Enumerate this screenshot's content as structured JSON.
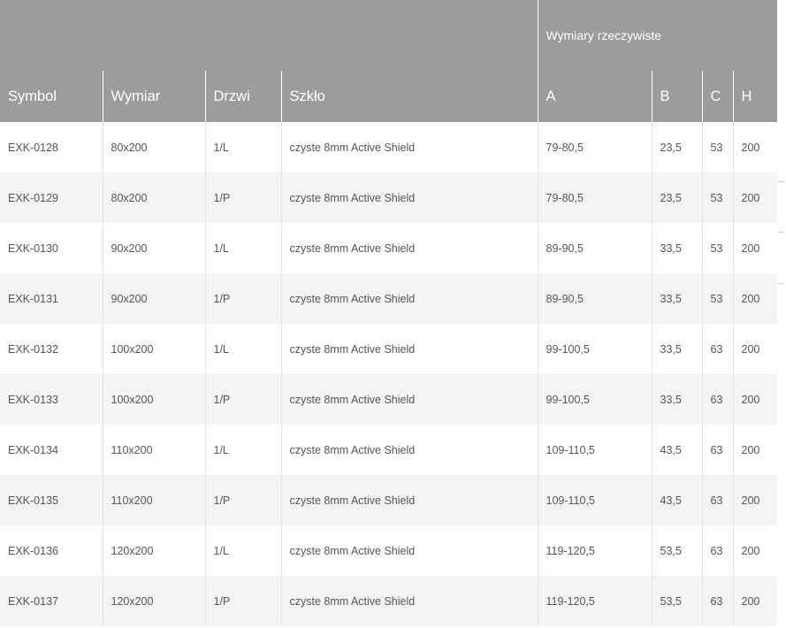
{
  "table": {
    "group_header": "Wymiary rzeczywiste",
    "columns": {
      "symbol": "Symbol",
      "wymiar": "Wymiar",
      "drzwi": "Drzwi",
      "szklo": "Szkło",
      "a": "A",
      "b": "B",
      "c": "C",
      "h": "H"
    },
    "rows": [
      {
        "symbol": "EXK-0128",
        "wymiar": "80x200",
        "drzwi": "1/L",
        "szklo": "czyste 8mm Active Shield",
        "a": "79-80,5",
        "b": "23,5",
        "c": "53",
        "h": "200"
      },
      {
        "symbol": "EXK-0129",
        "wymiar": "80x200",
        "drzwi": "1/P",
        "szklo": "czyste 8mm Active Shield",
        "a": "79-80,5",
        "b": "23,5",
        "c": "53",
        "h": "200"
      },
      {
        "symbol": "EXK-0130",
        "wymiar": "90x200",
        "drzwi": "1/L",
        "szklo": "czyste 8mm Active Shield",
        "a": "89-90,5",
        "b": "33,5",
        "c": "53",
        "h": "200"
      },
      {
        "symbol": "EXK-0131",
        "wymiar": "90x200",
        "drzwi": "1/P",
        "szklo": "czyste 8mm Active Shield",
        "a": "89-90,5",
        "b": "33,5",
        "c": "53",
        "h": "200"
      },
      {
        "symbol": "EXK-0132",
        "wymiar": "100x200",
        "drzwi": "1/L",
        "szklo": "czyste 8mm Active Shield",
        "a": "99-100,5",
        "b": "33,5",
        "c": "63",
        "h": "200"
      },
      {
        "symbol": "EXK-0133",
        "wymiar": "100x200",
        "drzwi": "1/P",
        "szklo": "czyste 8mm Active Shield",
        "a": "99-100,5",
        "b": "33,5",
        "c": "63",
        "h": "200"
      },
      {
        "symbol": "EXK-0134",
        "wymiar": "110x200",
        "drzwi": "1/L",
        "szklo": "czyste 8mm Active Shield",
        "a": "109-110,5",
        "b": "43,5",
        "c": "63",
        "h": "200"
      },
      {
        "symbol": "EXK-0135",
        "wymiar": "110x200",
        "drzwi": "1/P",
        "szklo": "czyste 8mm Active Shield",
        "a": "109-110,5",
        "b": "43,5",
        "c": "63",
        "h": "200"
      },
      {
        "symbol": "EXK-0136",
        "wymiar": "120x200",
        "drzwi": "1/L",
        "szklo": "czyste 8mm Active Shield",
        "a": "119-120,5",
        "b": "53,5",
        "c": "63",
        "h": "200"
      },
      {
        "symbol": "EXK-0137",
        "wymiar": "120x200",
        "drzwi": "1/P",
        "szklo": "czyste 8mm Active Shield",
        "a": "119-120,5",
        "b": "53,5",
        "c": "63",
        "h": "200"
      }
    ]
  },
  "colors": {
    "header_bg": "#9c9c9c",
    "header_text": "#ffffff",
    "row_alt_bg": "#f4f4f4",
    "cell_text": "#555555"
  }
}
